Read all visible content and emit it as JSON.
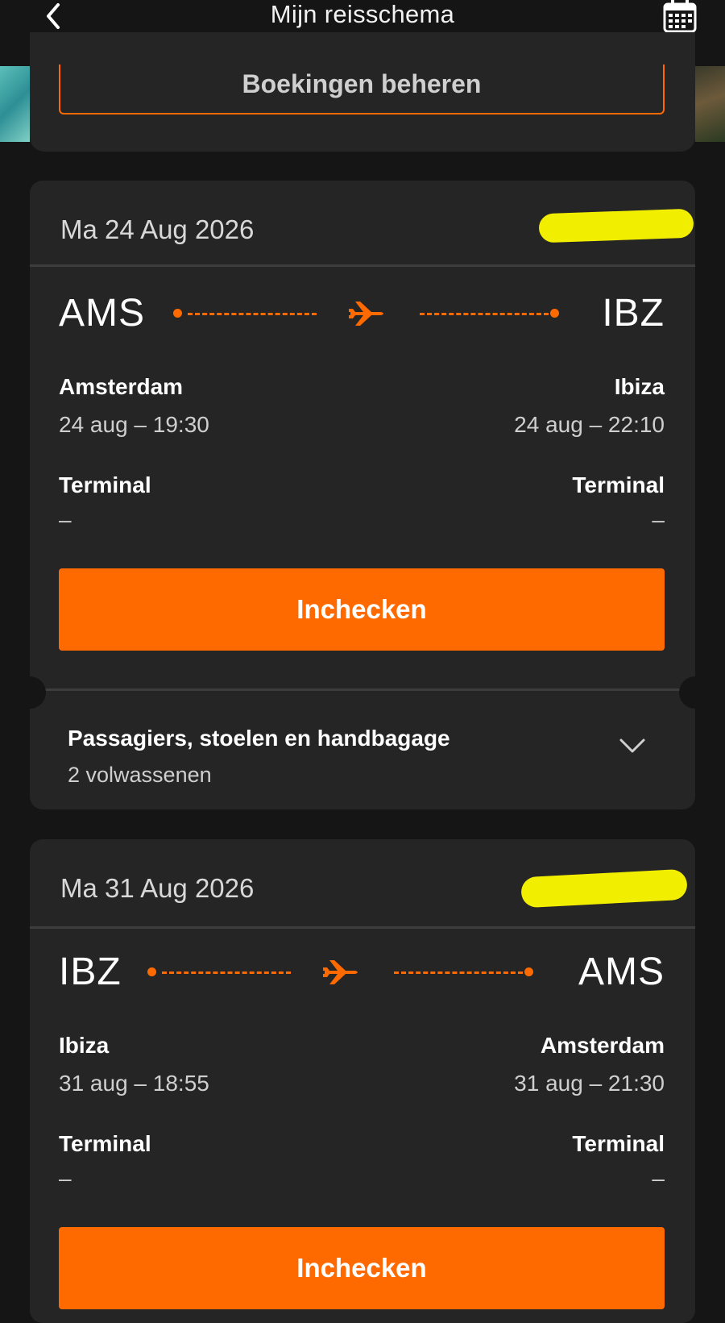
{
  "header": {
    "title": "Mijn reisschema",
    "back_icon": "chevron-left-icon",
    "calendar_icon": "calendar-icon"
  },
  "manage": {
    "label": "Boekingen beheren"
  },
  "flights": [
    {
      "date": "Ma 24 Aug 2026",
      "from": {
        "code": "AMS",
        "city": "Amsterdam",
        "time": "24 aug – 19:30",
        "terminal_label": "Terminal",
        "terminal_value": "–"
      },
      "to": {
        "code": "IBZ",
        "city": "Ibiza",
        "time": "24 aug – 22:10",
        "terminal_label": "Terminal",
        "terminal_value": "–"
      },
      "checkin_label": "Inchecken",
      "passengers": {
        "title": "Passagiers, stoelen en handbagage",
        "subtitle": "2 volwassenen"
      }
    },
    {
      "date": "Ma 31 Aug 2026",
      "from": {
        "code": "IBZ",
        "city": "Ibiza",
        "time": "31 aug – 18:55",
        "terminal_label": "Terminal",
        "terminal_value": "–"
      },
      "to": {
        "code": "AMS",
        "city": "Amsterdam",
        "time": "31 aug – 21:30",
        "terminal_label": "Terminal",
        "terminal_value": "–"
      },
      "checkin_label": "Inchecken"
    }
  ],
  "colors": {
    "accent": "#ff6a00",
    "card": "#252525",
    "background": "#151515",
    "redaction": "#f2ee00"
  }
}
